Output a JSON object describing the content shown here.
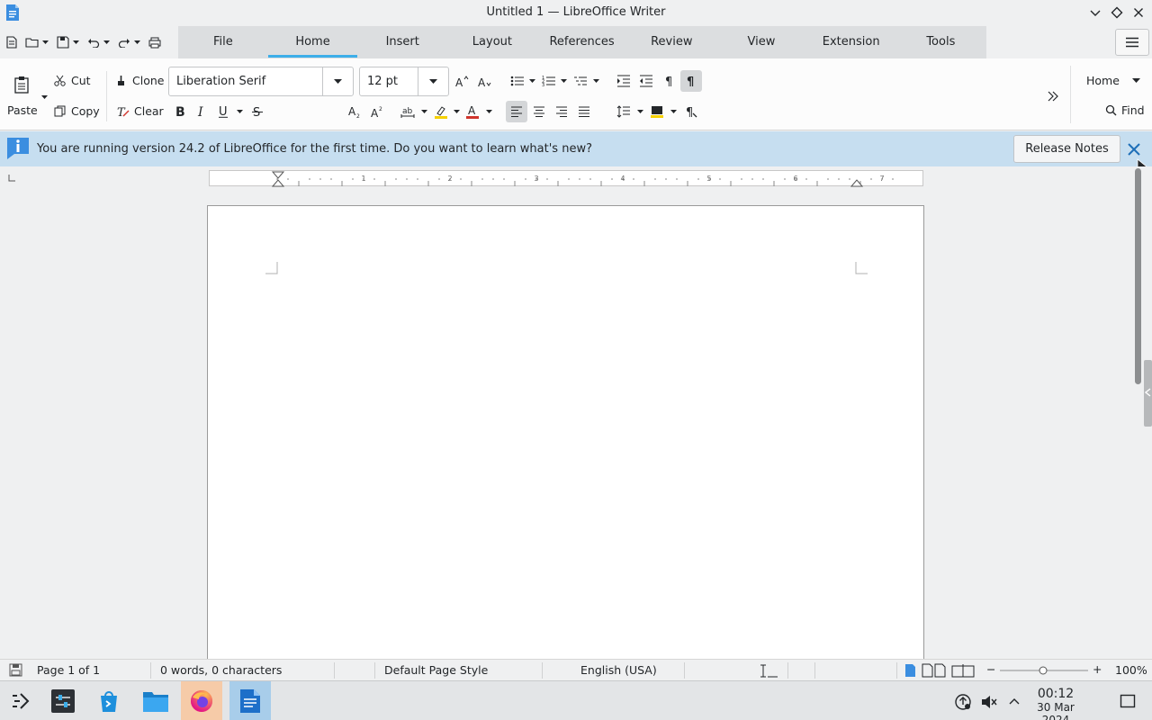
{
  "window": {
    "title": "Untitled 1 — LibreOffice Writer"
  },
  "tabs": [
    {
      "label": "File"
    },
    {
      "label": "Home"
    },
    {
      "label": "Insert"
    },
    {
      "label": "Layout"
    },
    {
      "label": "References"
    },
    {
      "label": "Review"
    },
    {
      "label": "View"
    },
    {
      "label": "Extension"
    },
    {
      "label": "Tools"
    }
  ],
  "active_tab": "Home",
  "toolbar": {
    "paste_label": "Paste",
    "cut_label": "Cut",
    "copy_label": "Copy",
    "clone_label": "Clone",
    "clear_label": "Clear",
    "font_name": "Liberation Serif",
    "font_size": "12 pt",
    "home_menu_label": "Home",
    "find_label": "Find"
  },
  "infobar": {
    "message": "You are running version 24.2 of LibreOffice for the first time. Do you want to learn what's new?",
    "release_notes_label": "Release Notes"
  },
  "ruler": {
    "labels": [
      "1",
      "2",
      "3",
      "4",
      "5",
      "6",
      "7"
    ]
  },
  "statusbar": {
    "page": "Page 1 of 1",
    "words": "0 words, 0 characters",
    "page_style": "Default Page Style",
    "language": "English (USA)",
    "zoom": "100%"
  },
  "taskbar": {
    "time": "00:12",
    "date": "30 Mar 2024"
  },
  "colors": {
    "accent": "#3daee9",
    "infobar_bg": "#c6def0",
    "highlight_yellow": "#f5d000",
    "font_color_red": "#d0342c"
  }
}
